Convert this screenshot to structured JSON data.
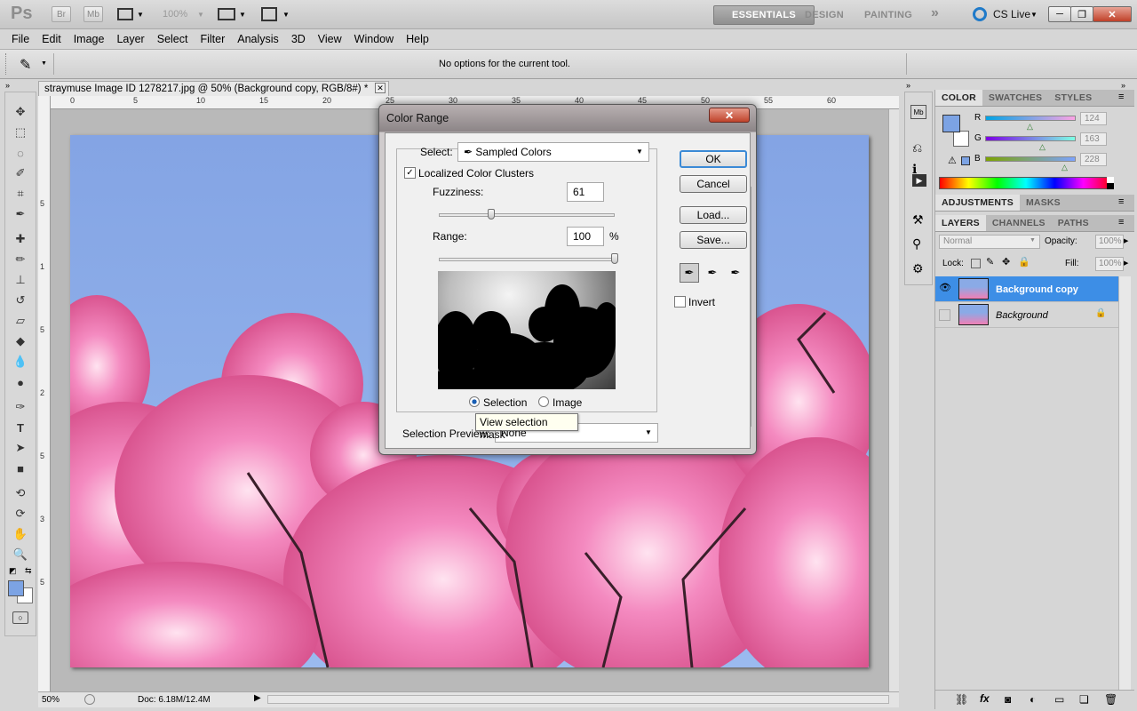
{
  "app": {
    "logo": "Ps",
    "bridge_label": "Br",
    "minibridge_label": "Mb",
    "zoom": "100%",
    "workspaces": [
      "ESSENTIALS",
      "DESIGN",
      "PAINTING"
    ],
    "more": "»",
    "cslive": "CS Live"
  },
  "menu": [
    "File",
    "Edit",
    "Image",
    "Layer",
    "Select",
    "Filter",
    "Analysis",
    "3D",
    "View",
    "Window",
    "Help"
  ],
  "options": {
    "text": "No options for the current tool."
  },
  "document": {
    "tab_title": "straymuse Image ID 1278217.jpg @ 50% (Background copy, RGB/8#) *",
    "ruler_top": [
      "0",
      "5",
      "10",
      "15",
      "20",
      "25",
      "30",
      "35",
      "40",
      "45",
      "50",
      "55",
      "60"
    ],
    "ruler_left": [
      "5",
      "1",
      "5",
      "2",
      "5",
      "3",
      "5"
    ],
    "status_zoom": "50%",
    "status_doc": "Doc: 6.18M/12.4M"
  },
  "dialog": {
    "title": "Color Range",
    "select_label": "Select:",
    "select_value": "Sampled Colors",
    "localized_label": "Localized Color Clusters",
    "localized_checked": true,
    "fuzziness_label": "Fuzziness:",
    "fuzziness_value": "61",
    "fuzziness_fraction": 0.3,
    "range_label": "Range:",
    "range_value": "100",
    "range_unit": "%",
    "range_fraction": 1.0,
    "radio_selection": "Selection",
    "radio_image": "Image",
    "preview_label": "Selection Preview:",
    "preview_value": "None",
    "ok": "OK",
    "cancel": "Cancel",
    "load": "Load...",
    "save": "Save...",
    "invert": "Invert",
    "tooltip": "View selection mask"
  },
  "color_panel": {
    "tabs": [
      "COLOR",
      "SWATCHES",
      "STYLES"
    ],
    "r_label": "R",
    "r_value": "124",
    "g_label": "G",
    "g_value": "163",
    "b_label": "B",
    "b_value": "228",
    "foreground": "#7ca3e4"
  },
  "adjust_tabs": [
    "ADJUSTMENTS",
    "MASKS"
  ],
  "layers_panel": {
    "tabs": [
      "LAYERS",
      "CHANNELS",
      "PATHS"
    ],
    "blend_mode": "Normal",
    "opacity_label": "Opacity:",
    "opacity_value": "100%",
    "lock_label": "Lock:",
    "fill_label": "Fill:",
    "fill_value": "100%",
    "layers": [
      "Background copy",
      "Background"
    ]
  },
  "colors": {
    "selected_layer": "#3d8ee6",
    "sky": "#8aaae6",
    "blossom": "#f07fb5"
  }
}
